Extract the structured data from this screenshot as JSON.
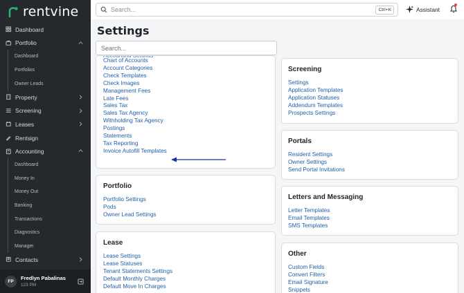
{
  "brand": {
    "name": "rentvine",
    "color": "#2fb06c"
  },
  "topbar": {
    "search_placeholder": "Search...",
    "search_shortcut": "Ctrl+K",
    "assistant_label": "Assistant"
  },
  "sidebar": {
    "items": [
      {
        "label": "Dashboard",
        "icon": "dashboard-icon",
        "type": "item"
      },
      {
        "label": "Portfolio",
        "icon": "portfolio-icon",
        "type": "item",
        "expanded": true
      },
      {
        "label": "Dashboard",
        "type": "sub"
      },
      {
        "label": "Portfolios",
        "type": "sub"
      },
      {
        "label": "Owner Leads",
        "type": "sub"
      },
      {
        "label": "Property",
        "icon": "building-icon",
        "type": "item",
        "expanded": false
      },
      {
        "label": "Screening",
        "icon": "screening-icon",
        "type": "item",
        "expanded": false
      },
      {
        "label": "Leases",
        "icon": "lease-icon",
        "type": "item",
        "expanded": false
      },
      {
        "label": "Rentsign",
        "icon": "pen-icon",
        "type": "item"
      },
      {
        "label": "Accounting",
        "icon": "accounting-icon",
        "type": "item",
        "expanded": true
      },
      {
        "label": "Dashboard",
        "type": "sub"
      },
      {
        "label": "Money In",
        "type": "sub"
      },
      {
        "label": "Money Out",
        "type": "sub"
      },
      {
        "label": "Banking",
        "type": "sub"
      },
      {
        "label": "Transactions",
        "type": "sub"
      },
      {
        "label": "Diagnostics",
        "type": "sub"
      },
      {
        "label": "Manager",
        "type": "sub"
      },
      {
        "label": "Contacts",
        "icon": "contacts-icon",
        "type": "item",
        "expanded": false
      }
    ],
    "user": {
      "initials": "FP",
      "name": "Fredlyn Pabalinas",
      "sub": "123 PM"
    }
  },
  "page": {
    "title": "Settings",
    "search_placeholder": "Search..."
  },
  "cards": {
    "accounting": {
      "links": [
        "Chart of Accounts",
        "Account Categories",
        "Check Templates",
        "Check Images",
        "Management Fees",
        "Late Fees",
        "Sales Tax",
        "Sales Tax Agency",
        "Withholding Tax Agency",
        "Postings",
        "Statements",
        "Tax Reporting",
        "Invoice Autofill Templates"
      ]
    },
    "portfolio": {
      "title": "Portfolio",
      "links": [
        "Portfolio Settings",
        "Pods",
        "Owner Lead Settings"
      ]
    },
    "lease": {
      "title": "Lease",
      "links": [
        "Lease Settings",
        "Lease Statuses",
        "Tenant Statements Settings",
        "Default Monthly Charges",
        "Default Move In Charges"
      ]
    },
    "screening": {
      "title": "Screening",
      "links": [
        "Settings",
        "Application Templates",
        "Application Statuses",
        "Addendum Templates",
        "Prospects Settings"
      ]
    },
    "portals": {
      "title": "Portals",
      "links": [
        "Resident Settings",
        "Owner Settings",
        "Send Portal Invitations"
      ]
    },
    "letters": {
      "title": "Letters and Messaging",
      "links": [
        "Letter Templates",
        "Email Templates",
        "SMS Templates"
      ]
    },
    "other": {
      "title": "Other",
      "links": [
        "Custom Fields",
        "Convert Filters",
        "Email Signature",
        "Snippets"
      ]
    }
  },
  "annotation": {
    "arrow_color": "#1a2fa8",
    "points_to": "Invoice Autofill Templates"
  },
  "colors": {
    "sidebar_bg": "#24292e",
    "link": "#1f5fa8",
    "page_bg": "#f4f5f7"
  }
}
